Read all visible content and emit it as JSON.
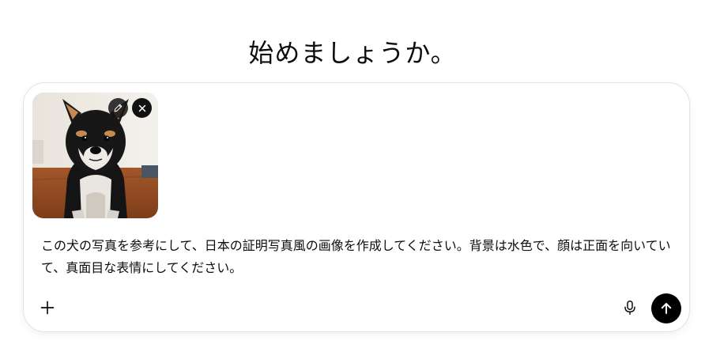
{
  "heading": "始めましょうか。",
  "composer": {
    "attachment": {
      "kind": "image",
      "subject": "shiba-inu-dog-photo",
      "edit_icon": "pencil-icon",
      "remove_icon": "close-icon"
    },
    "prompt_text": "この犬の写真を参考にして、日本の証明写真風の画像を作成してください。背景は水色で、顔は正面を向いていて、真面目な表情にしてください。",
    "add_icon": "plus-icon",
    "mic_icon": "microphone-icon",
    "send_icon": "arrow-up-icon"
  },
  "colors": {
    "send_button_bg": "#000000",
    "border": "#e3e3e3",
    "text": "#0d0d0d"
  }
}
